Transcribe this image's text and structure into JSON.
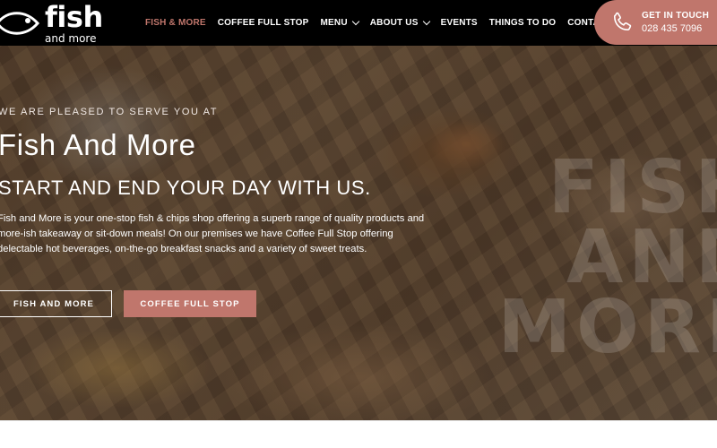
{
  "header": {
    "logo": {
      "word": "fish",
      "sub": "and more"
    },
    "nav": [
      {
        "label": "FISH & MORE",
        "active": true,
        "dropdown": false
      },
      {
        "label": "COFFEE FULL STOP",
        "active": false,
        "dropdown": false
      },
      {
        "label": "MENU",
        "active": false,
        "dropdown": true
      },
      {
        "label": "ABOUT US",
        "active": false,
        "dropdown": true
      },
      {
        "label": "EVENTS",
        "active": false,
        "dropdown": false
      },
      {
        "label": "THINGS TO DO",
        "active": false,
        "dropdown": false
      },
      {
        "label": "CONTACT",
        "active": false,
        "dropdown": false
      }
    ],
    "cta": {
      "title": "GET IN TOUCH",
      "phone": "028 435 7096",
      "icon": "phone-icon"
    }
  },
  "hero": {
    "eyebrow": "WE ARE PLEASED TO SERVE YOU AT",
    "title": "Fish And More",
    "subtitle": "START AND END YOUR DAY WITH US.",
    "body": "Fish and More is your one-stop fish & chips shop offering a superb range of quality products and more-ish takeaway or sit-down meals! On our premises we have Coffee Full Stop offering delectable hot beverages, on-the-go breakfast snacks and a variety of sweet treats.",
    "buttons": {
      "primary": "FISH AND MORE",
      "secondary": "COFFEE FULL STOP"
    },
    "watermark": {
      "line1": "FISH",
      "line2": "AND",
      "line3": "MORE"
    }
  },
  "colors": {
    "accent": "#c0766c",
    "header_bg": "#000000",
    "white": "#ffffff"
  }
}
